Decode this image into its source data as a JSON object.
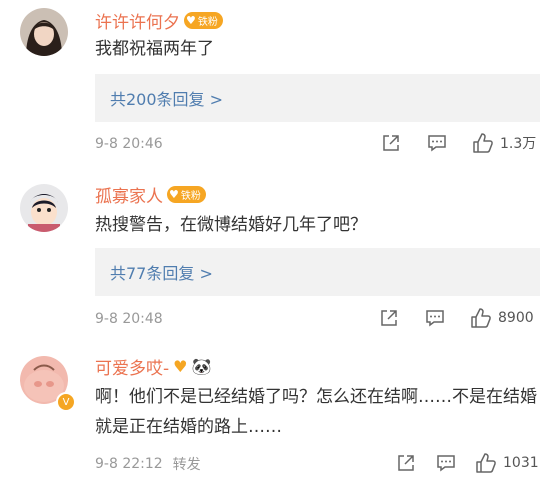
{
  "comments": [
    {
      "username": "许许许何夕",
      "badge": "铁粉",
      "text": "我都祝福两年了",
      "reply_summary": "共200条回复 >",
      "time": "9-8 20:46",
      "likes": "1.3万"
    },
    {
      "username": "孤寡家人",
      "badge": "铁粉",
      "text": "热搜警告，在微博结婚好几年了吧？",
      "reply_summary": "共77条回复 >",
      "time": "9-8 20:48",
      "likes": "8900"
    },
    {
      "username": "可爱多哎-",
      "text": "啊！他们不是已经结婚了吗？怎么还在结啊……不是在结婚就是正在结婚的路上……",
      "time": "9-8 22:12",
      "repost_label": "转发",
      "likes": "1031",
      "panda_emoji": "🐼"
    }
  ],
  "colors": {
    "username": "#eb7350",
    "link": "#507daf",
    "meta": "#999999",
    "badge": "#f6a623"
  }
}
